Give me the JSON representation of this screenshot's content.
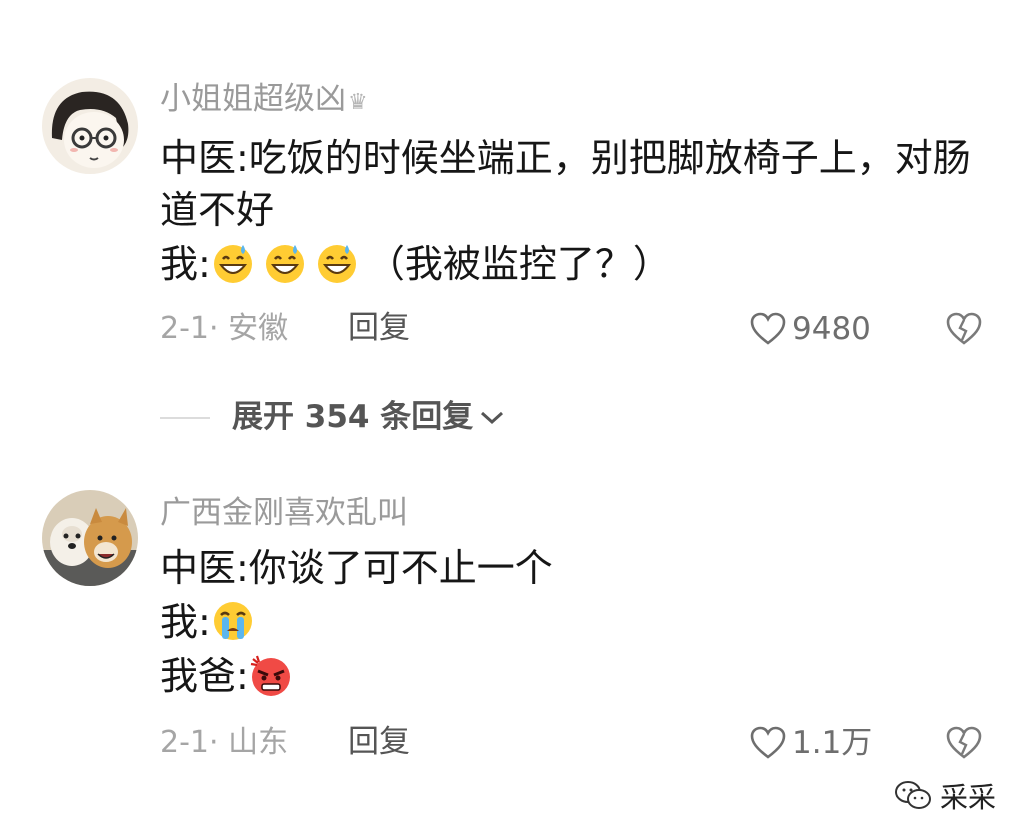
{
  "comments": [
    {
      "username": "小姐姐超级凶",
      "badge_icon": "crown-icon",
      "avatar_icon": "cartoon-girl-avatar",
      "lines": [
        "中医:吃饭的时候坐端正，别把脚放椅子上，对肠道不好",
        "我:",
        "（我被监控了？）"
      ],
      "emoji_icons": [
        "grinning-sweat-emoji",
        "grinning-sweat-emoji",
        "grinning-sweat-emoji"
      ],
      "date": "2-1",
      "separator": "·",
      "location": "安徽",
      "reply_label": "回复",
      "like_icon": "heart-outline-icon",
      "like_count": "9480",
      "dislike_icon": "broken-heart-icon"
    },
    {
      "username": "广西金刚喜欢乱叫",
      "avatar_icon": "two-dogs-avatar",
      "lines": [
        "中医:你谈了可不止一个",
        "我:",
        "我爸:"
      ],
      "emoji_icons": [
        "crying-face-emoji",
        "angry-face-emoji"
      ],
      "date": "2-1",
      "separator": "·",
      "location": "山东",
      "reply_label": "回复",
      "like_icon": "heart-outline-icon",
      "like_count": "1.1万",
      "dislike_icon": "broken-heart-icon"
    }
  ],
  "expand_replies": {
    "label": "展开 354 条回复",
    "icon": "chevron-down-icon"
  },
  "watermark": {
    "icon": "wechat-icon",
    "text": "采采"
  },
  "colors": {
    "username": "#9a9a9a",
    "text": "#161616",
    "meta": "#a5a5a5",
    "action": "#555555"
  }
}
